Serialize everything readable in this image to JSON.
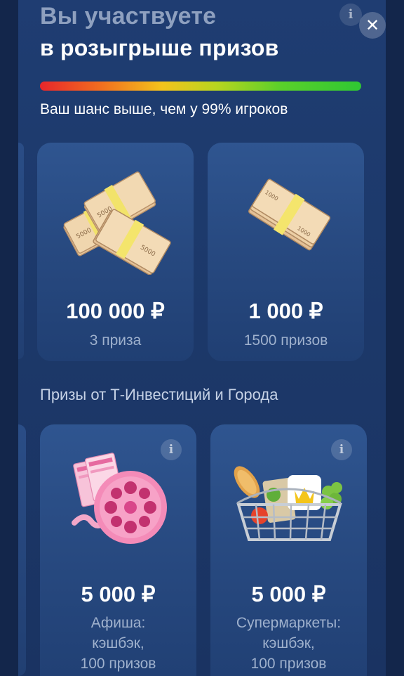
{
  "header": {
    "title_line1": "Вы участвуете",
    "title_line2": "в розыгрыше призов",
    "info_icon": "i",
    "close_icon": "✕"
  },
  "chance": {
    "text": "Ваш шанс выше, чем у 99% игроков",
    "gradient_colors": [
      "#e8262b",
      "#f3c31c",
      "#2fc733"
    ]
  },
  "main_prizes": [
    {
      "amount": "100 000 ₽",
      "count": "3 приза",
      "icon": "money-stacks-icon"
    },
    {
      "amount": "1 000 ₽",
      "count": "1500 призов",
      "icon": "money-stack-icon"
    }
  ],
  "partner_section": {
    "title": "Призы от Т-Инвестиций и Города",
    "prizes": [
      {
        "amount": "5 000 ₽",
        "line1": "Афиша:",
        "line2": "кэшбэк,",
        "line3": "100 призов",
        "icon": "film-reel-tickets-icon",
        "info_icon": "i"
      },
      {
        "amount": "5 000 ₽",
        "line1": "Супермаркеты:",
        "line2": "кэшбэк,",
        "line3": "100 призов",
        "icon": "grocery-basket-icon",
        "info_icon": "i"
      }
    ]
  }
}
